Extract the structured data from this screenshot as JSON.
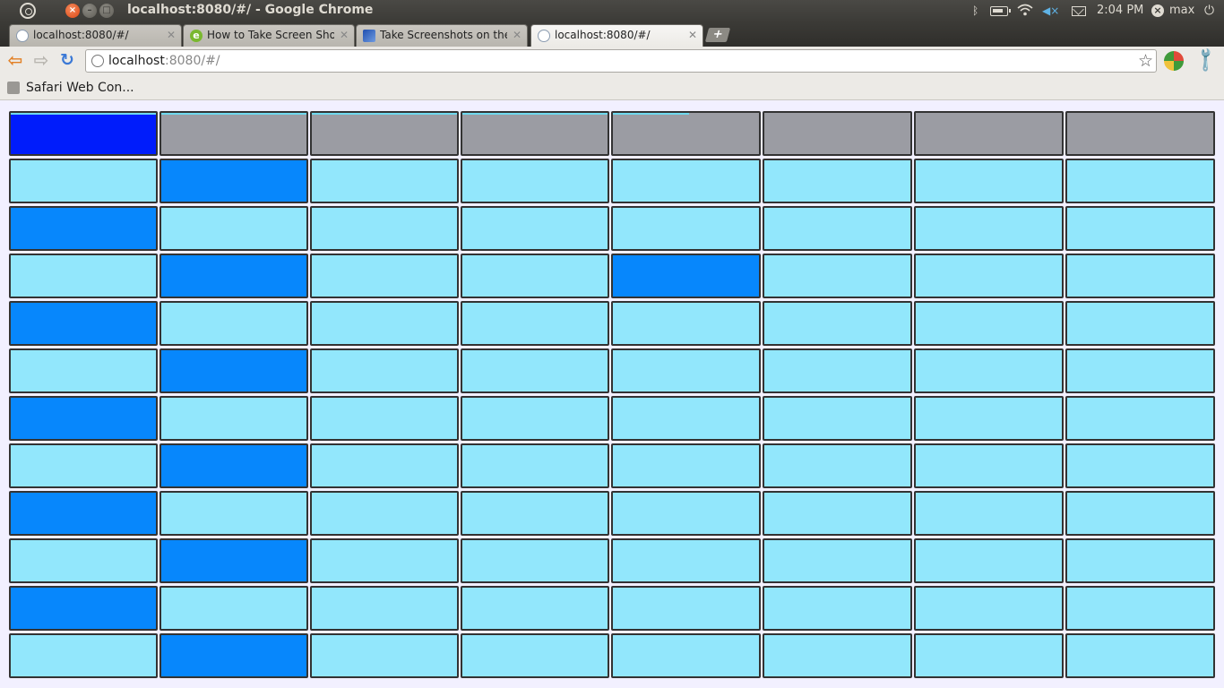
{
  "window": {
    "title": "localhost:8080/#/ - Google Chrome"
  },
  "panel": {
    "clock": "2:04 PM",
    "user": "max"
  },
  "tabs": [
    {
      "title": "localhost:8080/#/",
      "favicon": "page-icon",
      "active": false
    },
    {
      "title": "How to Take Screen Shot o",
      "favicon": "e-icon",
      "active": false
    },
    {
      "title": "Take Screenshots on the H",
      "favicon": "blue-site-icon",
      "active": false
    },
    {
      "title": "localhost:8080/#/",
      "favicon": "page-icon",
      "active": true
    }
  ],
  "omnibox": {
    "host": "localhost",
    "rest": ":8080/#/"
  },
  "bookmarks": [
    {
      "label": "Safari Web Con..."
    }
  ],
  "colors": {
    "gray": "#9b9ca3",
    "light": "#92e7fc",
    "mid": "#0787fc",
    "dark": "#001cfb",
    "progress": "#6fd9ee"
  },
  "grid": {
    "columns": 8,
    "rows": [
      [
        "dark",
        "gray",
        "gray",
        "gray",
        "gray",
        "gray",
        "gray",
        "gray"
      ],
      [
        "light",
        "mid",
        "light",
        "light",
        "light",
        "light",
        "light",
        "light"
      ],
      [
        "mid",
        "light",
        "light",
        "light",
        "light",
        "light",
        "light",
        "light"
      ],
      [
        "light",
        "mid",
        "light",
        "light",
        "mid",
        "light",
        "light",
        "light"
      ],
      [
        "mid",
        "light",
        "light",
        "light",
        "light",
        "light",
        "light",
        "light"
      ],
      [
        "light",
        "mid",
        "light",
        "light",
        "light",
        "light",
        "light",
        "light"
      ],
      [
        "mid",
        "light",
        "light",
        "light",
        "light",
        "light",
        "light",
        "light"
      ],
      [
        "light",
        "mid",
        "light",
        "light",
        "light",
        "light",
        "light",
        "light"
      ],
      [
        "mid",
        "light",
        "light",
        "light",
        "light",
        "light",
        "light",
        "light"
      ],
      [
        "light",
        "mid",
        "light",
        "light",
        "light",
        "light",
        "light",
        "light"
      ],
      [
        "mid",
        "light",
        "light",
        "light",
        "light",
        "light",
        "light",
        "light"
      ],
      [
        "light",
        "mid",
        "light",
        "light",
        "light",
        "light",
        "light",
        "light"
      ]
    ],
    "header_progress": [
      1.0,
      1.0,
      1.0,
      1.0,
      0.52,
      0,
      0,
      0
    ]
  }
}
